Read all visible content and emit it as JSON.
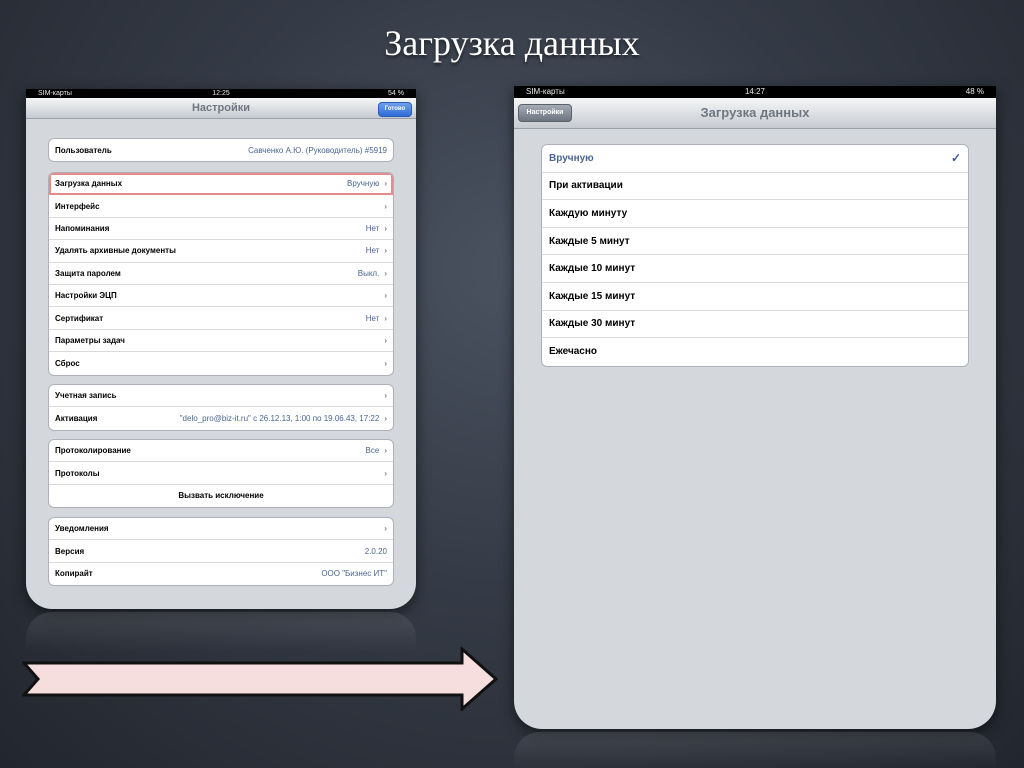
{
  "slide": {
    "title": "Загрузка данных"
  },
  "left_ipad": {
    "status": {
      "carrier": "SIM-карты",
      "time": "12:25",
      "battery": "54 %"
    },
    "navbar": {
      "title": "Настройки",
      "done_button": "Готово"
    },
    "group1": [
      {
        "label": "Пользователь",
        "value": "Савченко А.Ю. (Руководитель) #5919",
        "chevron": false
      }
    ],
    "group2": [
      {
        "label": "Загрузка данных",
        "value": "Вручную",
        "chevron": true
      },
      {
        "label": "Интерфейс",
        "value": "",
        "chevron": true
      },
      {
        "label": "Напоминания",
        "value": "Нет",
        "chevron": true
      },
      {
        "label": "Удалять архивные документы",
        "value": "Нет",
        "chevron": true
      },
      {
        "label": "Защита паролем",
        "value": "Выкл.",
        "chevron": true
      },
      {
        "label": "Настройки ЭЦП",
        "value": "",
        "chevron": true
      },
      {
        "label": "Сертификат",
        "value": "Нет",
        "chevron": true
      },
      {
        "label": "Параметры задач",
        "value": "",
        "chevron": true
      },
      {
        "label": "Сброс",
        "value": "",
        "chevron": true
      }
    ],
    "group3": [
      {
        "label": "Учетная запись",
        "value": "",
        "chevron": true
      },
      {
        "label": "Активация",
        "value": "\"delo_pro@biz-it.ru\" c 26.12.13, 1:00 по 19.06.43, 17:22",
        "chevron": true
      }
    ],
    "group4": [
      {
        "label": "Протоколирование",
        "value": "Все",
        "chevron": true
      },
      {
        "label": "Протоколы",
        "value": "",
        "chevron": true
      }
    ],
    "group4_button": "Вызвать исключение",
    "group5": [
      {
        "label": "Уведомления",
        "value": "",
        "chevron": true
      },
      {
        "label": "Версия",
        "value": "2.0.20",
        "chevron": false
      },
      {
        "label": "Копирайт",
        "value": "ООО \"Бизнес ИТ\"",
        "chevron": false
      }
    ]
  },
  "right_ipad": {
    "status": {
      "carrier": "SIM-карты",
      "time": "14:27",
      "battery": "48 %"
    },
    "navbar": {
      "title": "Загрузка данных",
      "back_button": "Настройки"
    },
    "options": [
      {
        "label": "Вручную",
        "selected": true
      },
      {
        "label": "При активации",
        "selected": false
      },
      {
        "label": "Каждую минуту",
        "selected": false
      },
      {
        "label": "Каждые 5 минут",
        "selected": false
      },
      {
        "label": "Каждые 10 минут",
        "selected": false
      },
      {
        "label": "Каждые 15 минут",
        "selected": false
      },
      {
        "label": "Каждые 30 минут",
        "selected": false
      },
      {
        "label": "Ежечасно",
        "selected": false
      }
    ],
    "check_mark": "✓"
  },
  "icons": {
    "chevron": "›",
    "arrow": "right-arrow-icon",
    "wifi": "wifi-icon"
  },
  "colors": {
    "value_text": "#4a6591",
    "done_button": "#2f6cd8",
    "highlight": "#e88a8a",
    "arrow_fill": "#f5dedd"
  }
}
